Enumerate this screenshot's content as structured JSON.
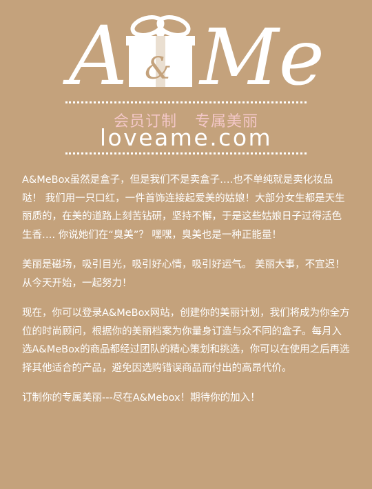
{
  "logo": {
    "text": "A&Me",
    "ampersand": "&"
  },
  "slogan": {
    "left": "会员订制",
    "right": "专属美丽"
  },
  "domain": "loveame.com",
  "paragraphs": [
    "A&MeBox虽然是盒子，但是我们不是卖盒子….也不单纯就是卖化妆品哒！ 我们用一只口红，一件首饰连接起爱美的姑娘！大部分女生都是天生丽质的，在美的道路上刻苦钻研，坚持不懈，于是这些姑娘日子过得活色生香…. 你说她们在“臭美”？ 嘿嘿，臭美也是一种正能量！",
    "美丽是磁场，吸引目光，吸引好心情，吸引好运气。 美丽大事，不宜迟！从今天开始，一起努力！",
    "现在，你可以登录A&MeBox网站，创建你的美丽计划，我们将成为你全方位的时尚顾问，根据你的美丽档案为你量身订造与众不同的盒子。每月入选A&MeBox的商品都经过团队的精心策划和挑选，你可以在使用之后再选择其他适合的产品，避免因选购错误商品而付出的高昂代价。",
    "订制你的专属美丽---尽在A&Mebox！期待你的加入！"
  ],
  "colors": {
    "background": "#c4a27c",
    "slogan": "#f3c7c7",
    "text": "#ffffff"
  }
}
